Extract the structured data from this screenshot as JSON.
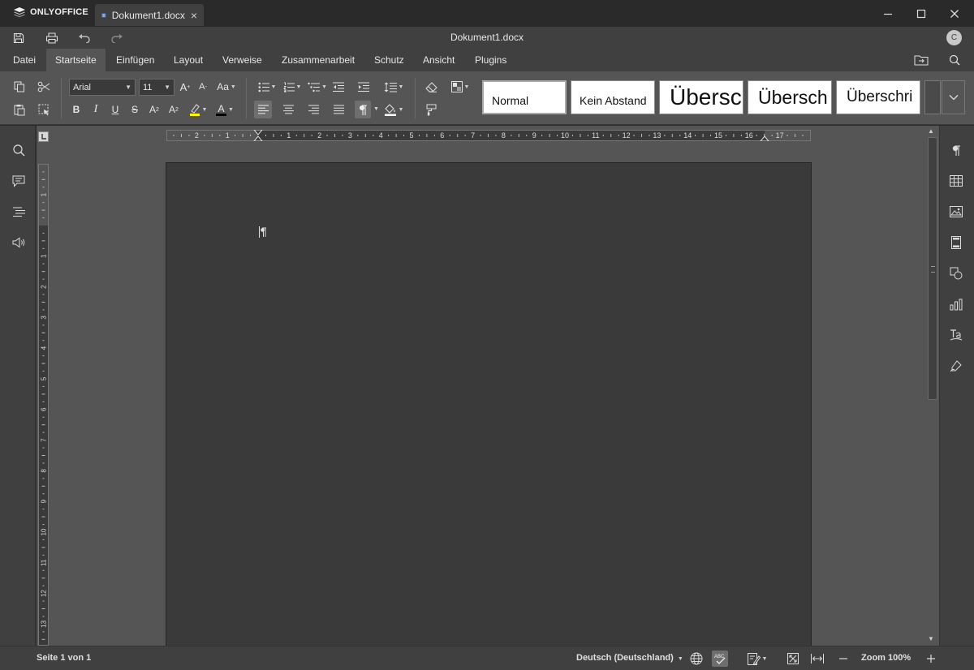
{
  "app": {
    "brand": "ONLYOFFICE"
  },
  "tab": {
    "title": "Dokument1.docx",
    "close": "×"
  },
  "quickbar": {
    "doc_title": "Dokument1.docx",
    "avatar_initial": "C"
  },
  "menu": {
    "tabs": [
      "Datei",
      "Startseite",
      "Einfügen",
      "Layout",
      "Verweise",
      "Zusammenarbeit",
      "Schutz",
      "Ansicht",
      "Plugins"
    ],
    "active": "Startseite"
  },
  "toolbar": {
    "font_name": "Arial",
    "font_size": "11",
    "grow_label": "A",
    "shrink_label": "A",
    "case_label": "Aa",
    "bold": "B",
    "italic": "I",
    "underline": "U",
    "strike": "S",
    "superscript": "A",
    "subscript": "A",
    "highlight_color": "#ffff00",
    "font_color_label": "A",
    "font_color": "#000000",
    "styles": [
      "Normal",
      "Kein Abstand",
      "Übersc",
      "Übersch",
      "Überschri"
    ]
  },
  "ruler": {
    "h_numbers": [
      "2",
      "1",
      "1",
      "2",
      "3",
      "4",
      "5",
      "6",
      "7",
      "8",
      "9",
      "10",
      "11",
      "12",
      "13",
      "14",
      "15",
      "16",
      "17"
    ],
    "v_numbers": [
      "1",
      "1",
      "2",
      "3",
      "4",
      "5",
      "6",
      "7",
      "8",
      "9",
      "10",
      "11",
      "12",
      "13"
    ]
  },
  "statusbar": {
    "page_count": "Seite 1 von 1",
    "language": "Deutsch (Deutschland)",
    "zoom": "Zoom 100%"
  },
  "colors": {
    "accent_active_tab": "#555555",
    "page": "#3a3a3a",
    "workspace": "#555555"
  }
}
